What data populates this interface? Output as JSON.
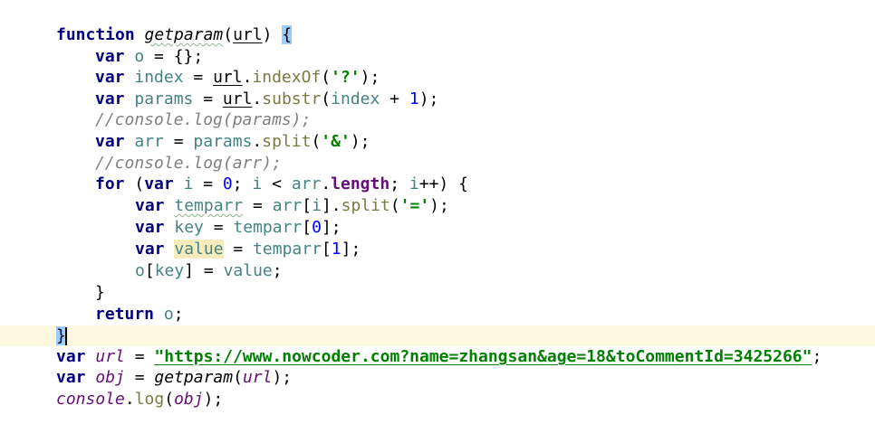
{
  "editor": {
    "lines": [
      {
        "tokens": [
          {
            "t": "function",
            "c": "kw"
          },
          {
            "t": " ",
            "c": ""
          },
          {
            "t": "getparam",
            "c": "fn-decl fn-decl-wavy"
          },
          {
            "t": "(",
            "c": ""
          },
          {
            "t": "url",
            "c": "param param-ul"
          },
          {
            "t": ") ",
            "c": ""
          },
          {
            "t": "{",
            "c": "brace-hl"
          }
        ]
      },
      {
        "tokens": [
          {
            "t": "var",
            "c": "kw"
          },
          {
            "t": " ",
            "c": ""
          },
          {
            "t": "o",
            "c": "local"
          },
          {
            "t": " = {};",
            "c": ""
          }
        ]
      },
      {
        "tokens": [
          {
            "t": "var",
            "c": "kw"
          },
          {
            "t": " ",
            "c": ""
          },
          {
            "t": "index",
            "c": "local"
          },
          {
            "t": " = ",
            "c": ""
          },
          {
            "t": "url",
            "c": "param param-ul"
          },
          {
            "t": ".",
            "c": ""
          },
          {
            "t": "indexOf",
            "c": "method"
          },
          {
            "t": "(",
            "c": ""
          },
          {
            "t": "'?'",
            "c": "str"
          },
          {
            "t": ");",
            "c": ""
          }
        ]
      },
      {
        "tokens": [
          {
            "t": "var",
            "c": "kw"
          },
          {
            "t": " ",
            "c": ""
          },
          {
            "t": "params",
            "c": "local"
          },
          {
            "t": " = ",
            "c": ""
          },
          {
            "t": "url",
            "c": "param param-ul"
          },
          {
            "t": ".",
            "c": ""
          },
          {
            "t": "substr",
            "c": "method"
          },
          {
            "t": "(",
            "c": ""
          },
          {
            "t": "index",
            "c": "local"
          },
          {
            "t": " + ",
            "c": ""
          },
          {
            "t": "1",
            "c": "num"
          },
          {
            "t": ");",
            "c": ""
          }
        ]
      },
      {
        "tokens": [
          {
            "t": "//console.log(params);",
            "c": "comment"
          }
        ]
      },
      {
        "tokens": [
          {
            "t": "var",
            "c": "kw"
          },
          {
            "t": " ",
            "c": ""
          },
          {
            "t": "arr",
            "c": "local"
          },
          {
            "t": " = ",
            "c": ""
          },
          {
            "t": "params",
            "c": "local"
          },
          {
            "t": ".",
            "c": ""
          },
          {
            "t": "split",
            "c": "method"
          },
          {
            "t": "(",
            "c": ""
          },
          {
            "t": "'&'",
            "c": "str"
          },
          {
            "t": ");",
            "c": ""
          }
        ]
      },
      {
        "tokens": [
          {
            "t": "//console.log(arr);",
            "c": "comment"
          }
        ]
      },
      {
        "tokens": [
          {
            "t": "for",
            "c": "kw"
          },
          {
            "t": " (",
            "c": ""
          },
          {
            "t": "var",
            "c": "kw"
          },
          {
            "t": " ",
            "c": ""
          },
          {
            "t": "i",
            "c": "local"
          },
          {
            "t": " = ",
            "c": ""
          },
          {
            "t": "0",
            "c": "num"
          },
          {
            "t": "; ",
            "c": ""
          },
          {
            "t": "i",
            "c": "local"
          },
          {
            "t": " < ",
            "c": ""
          },
          {
            "t": "arr",
            "c": "local"
          },
          {
            "t": ".",
            "c": ""
          },
          {
            "t": "length",
            "c": "prop"
          },
          {
            "t": "; ",
            "c": ""
          },
          {
            "t": "i",
            "c": "local"
          },
          {
            "t": "++) {",
            "c": ""
          }
        ]
      },
      {
        "tokens": [
          {
            "t": "var",
            "c": "kw"
          },
          {
            "t": " ",
            "c": ""
          },
          {
            "t": "temparr",
            "c": "local local-wavy"
          },
          {
            "t": " = ",
            "c": ""
          },
          {
            "t": "arr",
            "c": "local"
          },
          {
            "t": "[",
            "c": ""
          },
          {
            "t": "i",
            "c": "local"
          },
          {
            "t": "].",
            "c": ""
          },
          {
            "t": "split",
            "c": "method"
          },
          {
            "t": "(",
            "c": ""
          },
          {
            "t": "'='",
            "c": "str"
          },
          {
            "t": ");",
            "c": ""
          }
        ]
      },
      {
        "tokens": [
          {
            "t": "var",
            "c": "kw"
          },
          {
            "t": " ",
            "c": ""
          },
          {
            "t": "key",
            "c": "local"
          },
          {
            "t": " = ",
            "c": ""
          },
          {
            "t": "temparr",
            "c": "local"
          },
          {
            "t": "[",
            "c": ""
          },
          {
            "t": "0",
            "c": "num"
          },
          {
            "t": "];",
            "c": ""
          }
        ]
      },
      {
        "tokens": [
          {
            "t": "var",
            "c": "kw"
          },
          {
            "t": " ",
            "c": ""
          },
          {
            "t": "value",
            "c": "local value-hl"
          },
          {
            "t": " = ",
            "c": ""
          },
          {
            "t": "temparr",
            "c": "local"
          },
          {
            "t": "[",
            "c": ""
          },
          {
            "t": "1",
            "c": "num"
          },
          {
            "t": "];",
            "c": ""
          }
        ]
      },
      {
        "tokens": [
          {
            "t": "o",
            "c": "local"
          },
          {
            "t": "[",
            "c": ""
          },
          {
            "t": "key",
            "c": "local"
          },
          {
            "t": "] = ",
            "c": ""
          },
          {
            "t": "value",
            "c": "local"
          },
          {
            "t": ";",
            "c": ""
          }
        ]
      },
      {
        "tokens": [
          {
            "t": "}",
            "c": ""
          }
        ]
      },
      {
        "tokens": [
          {
            "t": "return",
            "c": "kw"
          },
          {
            "t": " ",
            "c": ""
          },
          {
            "t": "o",
            "c": "local"
          },
          {
            "t": ";",
            "c": ""
          }
        ]
      },
      {
        "tokens": [
          {
            "t": "}",
            "c": "brace-hl"
          },
          {
            "t": "",
            "c": "caret"
          }
        ]
      },
      {
        "tokens": [
          {
            "t": "var",
            "c": "kw"
          },
          {
            "t": " ",
            "c": ""
          },
          {
            "t": "url",
            "c": "global"
          },
          {
            "t": " = ",
            "c": ""
          },
          {
            "t": "\"https://www.nowcoder.com?name=zhangsan&age=18&toCommentId=3425266\"",
            "c": "url-str"
          },
          {
            "t": ";",
            "c": ""
          }
        ]
      },
      {
        "tokens": [
          {
            "t": "var",
            "c": "kw"
          },
          {
            "t": " ",
            "c": ""
          },
          {
            "t": "obj",
            "c": "global"
          },
          {
            "t": " = ",
            "c": ""
          },
          {
            "t": "getparam",
            "c": "fn-decl"
          },
          {
            "t": "(",
            "c": ""
          },
          {
            "t": "url",
            "c": "global"
          },
          {
            "t": ");",
            "c": ""
          }
        ]
      },
      {
        "tokens": [
          {
            "t": "console",
            "c": "global"
          },
          {
            "t": ".",
            "c": ""
          },
          {
            "t": "log",
            "c": "method"
          },
          {
            "t": "(",
            "c": ""
          },
          {
            "t": "obj",
            "c": "global"
          },
          {
            "t": ");",
            "c": ""
          }
        ]
      }
    ]
  }
}
